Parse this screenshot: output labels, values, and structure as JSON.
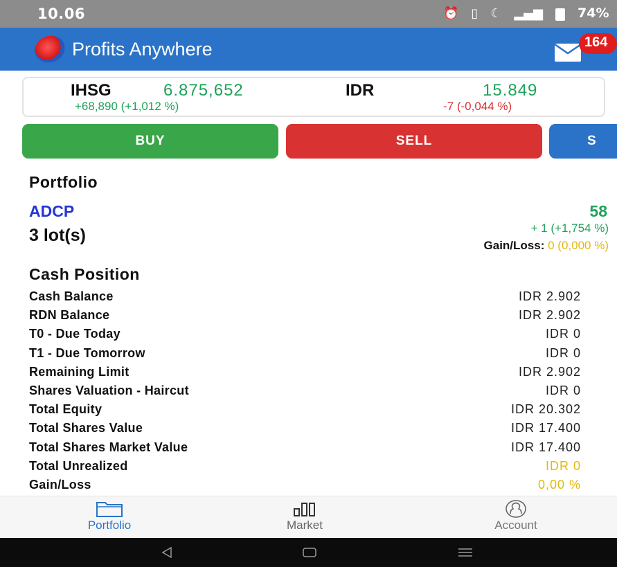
{
  "status_bar": {
    "time": "10.06",
    "battery": "74%"
  },
  "header": {
    "title": "Profits Anywhere",
    "mail_badge": "164"
  },
  "ticker": {
    "index_name": "IHSG",
    "index_value": "6.875,652",
    "index_change": "+68,890 (+1,012 %)",
    "currency_name": "IDR",
    "currency_value": "15.849",
    "currency_change": "-7 (-0,044 %)"
  },
  "actions": {
    "buy_label": "BUY",
    "sell_label": "SELL",
    "third_label": "S"
  },
  "portfolio": {
    "title": "Portfolio",
    "stock_code": "ADCP",
    "price": "58",
    "lots": "3 lot(s)",
    "change": "+ 1 (+1,754 %)",
    "gain_loss_label": "Gain/Loss:",
    "gain_loss_value": "0 (0,000 %)"
  },
  "cash_position": {
    "title": "Cash Position",
    "rows": [
      {
        "label": "Cash Balance",
        "value": "IDR 2.902"
      },
      {
        "label": "RDN Balance",
        "value": "IDR 2.902"
      },
      {
        "label": "T0 - Due Today",
        "value": "IDR 0"
      },
      {
        "label": "T1 - Due Tomorrow",
        "value": "IDR 0"
      },
      {
        "label": "Remaining Limit",
        "value": "IDR 2.902"
      },
      {
        "label": "Shares Valuation - Haircut",
        "value": "IDR 0"
      },
      {
        "label": "Total Equity",
        "value": "IDR 20.302"
      },
      {
        "label": "Total Shares Value",
        "value": "IDR 17.400"
      },
      {
        "label": "Total Shares Market Value",
        "value": "IDR 17.400"
      },
      {
        "label": "Total Unrealized",
        "value": "IDR 0"
      },
      {
        "label": "Gain/Loss",
        "value": "0,00 %"
      }
    ]
  },
  "bottom_nav": {
    "items": [
      {
        "label": "Portfolio",
        "icon": "folder-icon"
      },
      {
        "label": "Market",
        "icon": "bar-chart-icon"
      },
      {
        "label": "Account",
        "icon": "user-circle-icon"
      }
    ]
  },
  "colors": {
    "header_blue": "#2a73c8",
    "buy_green": "#3aa64a",
    "sell_red": "#d93232",
    "positive_green": "#1ea35a",
    "stock_blue": "#2435d6",
    "neutral_gold": "#e3b80e"
  }
}
